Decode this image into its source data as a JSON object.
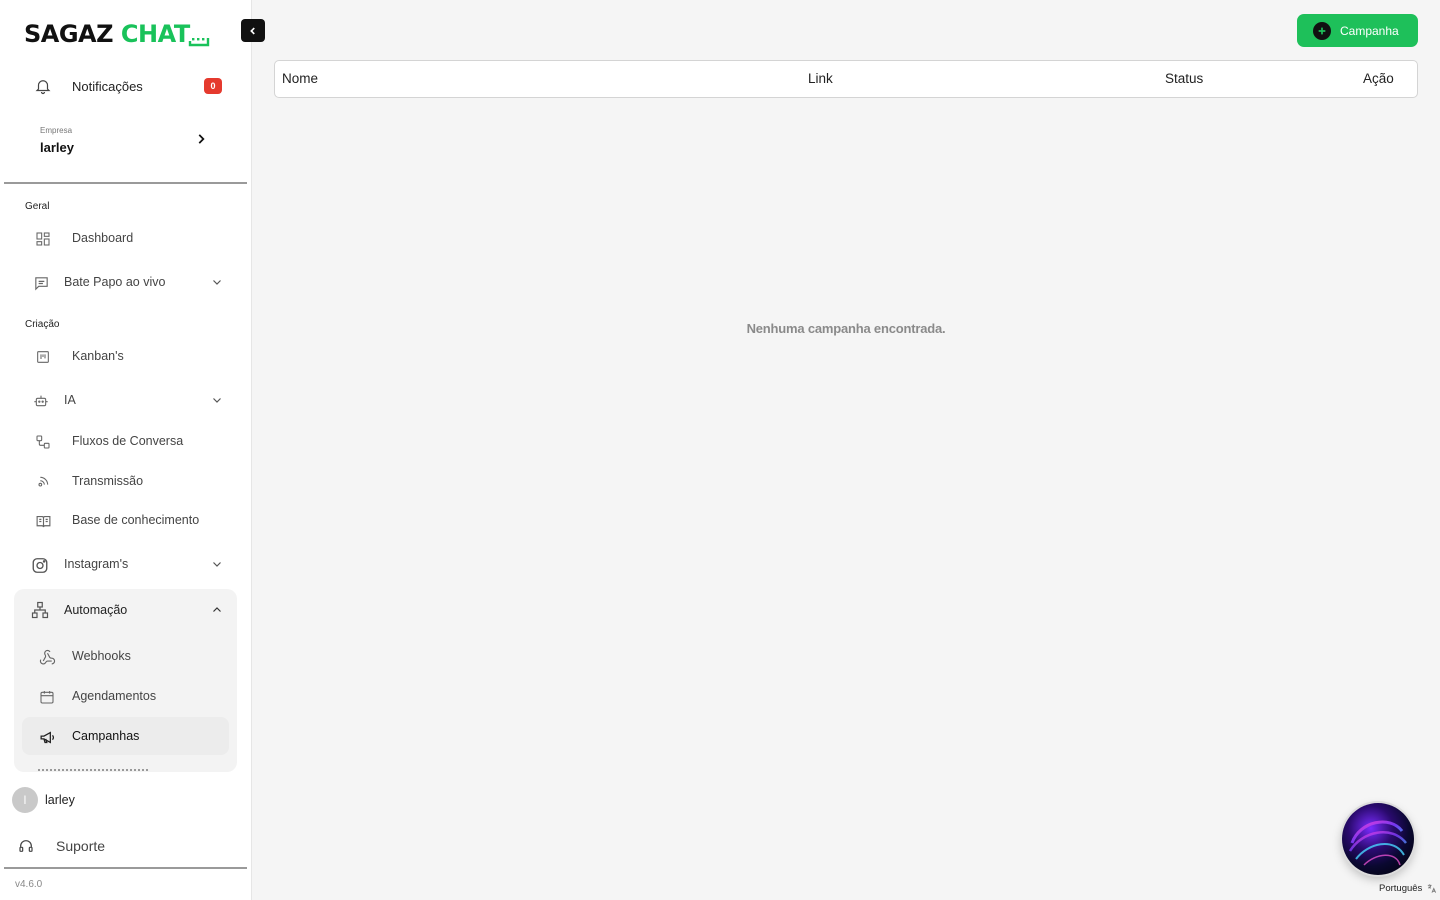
{
  "brand": {
    "name": "SAGAZ",
    "accent": "CHAT"
  },
  "notifications": {
    "label": "Notificações",
    "count": "0"
  },
  "company": {
    "caption": "Empresa",
    "name": "larley"
  },
  "sections": {
    "geral": "Geral",
    "criacao": "Criação"
  },
  "nav": {
    "dashboard": "Dashboard",
    "bate_papo": "Bate Papo ao vivo",
    "kanban": "Kanban's",
    "ia": "IA",
    "fluxos": "Fluxos de Conversa",
    "transmissao": "Transmissão",
    "base": "Base de conhecimento",
    "instagram": "Instagram's",
    "automacao": "Automação",
    "webhooks": "Webhooks",
    "agendamentos": "Agendamentos",
    "campanhas": "Campanhas"
  },
  "user": {
    "initial": "l",
    "name": "larley"
  },
  "support": {
    "label": "Suporte"
  },
  "version": "v4.6.0",
  "toolbar": {
    "add_label": "Campanha"
  },
  "table": {
    "columns": [
      "Nome",
      "Link",
      "Status",
      "Ação"
    ]
  },
  "empty_message": "Nenhuma campanha encontrada.",
  "language": "Português",
  "colors": {
    "accent": "#1ec05a",
    "badge": "#e53a2e",
    "active_bg": "#ececec"
  }
}
